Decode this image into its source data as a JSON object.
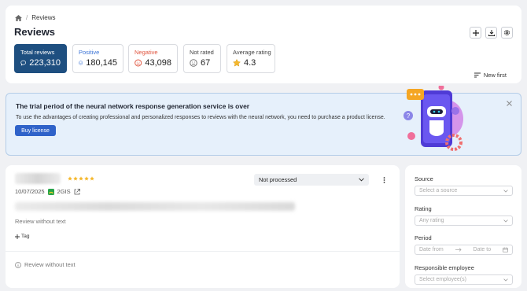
{
  "breadcrumb": {
    "current": "Reviews"
  },
  "page": {
    "title": "Reviews"
  },
  "stats": {
    "total": {
      "label": "Total reviews",
      "value": "223,310"
    },
    "positive": {
      "label": "Positive",
      "value": "180,145"
    },
    "negative": {
      "label": "Negative",
      "value": "43,098"
    },
    "not_rated": {
      "label": "Not rated",
      "value": "67"
    },
    "average": {
      "label": "Average rating",
      "value": "4.3"
    }
  },
  "sort": {
    "label": "New first"
  },
  "banner": {
    "title": "The trial period of the neural network response generation service is over",
    "text": "To use the advantages of creating professional and personalized responses to reviews with the neural network, you need to purchase a product license.",
    "button": "Buy license"
  },
  "review": {
    "date": "10/07/2025",
    "source": "2GIS",
    "no_text": "Review without text",
    "tag_label": "Tag",
    "info_text": "Review without text",
    "status": "Not processed",
    "rating": 5
  },
  "filters": {
    "source": {
      "label": "Source",
      "placeholder": "Select a source"
    },
    "rating": {
      "label": "Rating",
      "placeholder": "Any rating"
    },
    "period": {
      "label": "Period",
      "from": "Date from",
      "to": "Date to"
    },
    "employee": {
      "label": "Responsible employee",
      "placeholder": "Select employee(s)"
    }
  },
  "colors": {
    "primary": "#1e4f80",
    "accent": "#2f62c9",
    "positive": "#3a73d6",
    "negative": "#e0553f",
    "star": "#f5b82e",
    "banner_bg": "#e6f0fb"
  },
  "icons": [
    "home-icon",
    "plus-icon",
    "download-icon",
    "settings-icon",
    "chat-icon",
    "smile-icon",
    "sad-icon",
    "neutral-icon",
    "star-icon",
    "sort-icon",
    "close-icon",
    "external-link-icon",
    "more-icon",
    "info-icon",
    "chevron-down-icon",
    "calendar-icon",
    "arrow-right-icon"
  ]
}
